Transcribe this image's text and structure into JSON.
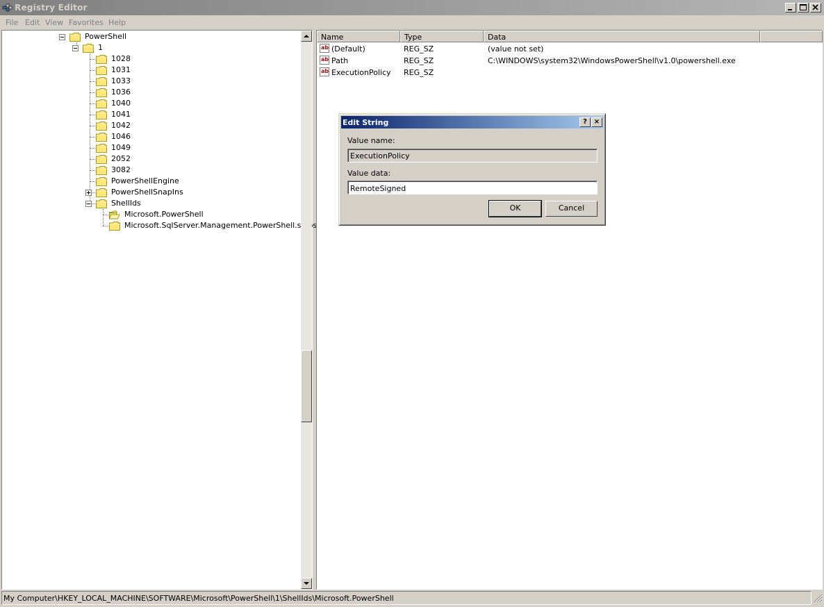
{
  "window": {
    "title": "Registry Editor"
  },
  "menu": [
    "File",
    "Edit",
    "View",
    "Favorites",
    "Help"
  ],
  "tree": [
    {
      "label": "PowerShell",
      "level": 0,
      "expander": "minus"
    },
    {
      "label": "1",
      "level": 1,
      "expander": "minus"
    },
    {
      "label": "1028",
      "level": 2
    },
    {
      "label": "1031",
      "level": 2
    },
    {
      "label": "1033",
      "level": 2
    },
    {
      "label": "1036",
      "level": 2
    },
    {
      "label": "1040",
      "level": 2
    },
    {
      "label": "1041",
      "level": 2
    },
    {
      "label": "1042",
      "level": 2
    },
    {
      "label": "1046",
      "level": 2
    },
    {
      "label": "1049",
      "level": 2
    },
    {
      "label": "2052",
      "level": 2
    },
    {
      "label": "3082",
      "level": 2
    },
    {
      "label": "PowerShellEngine",
      "level": 2
    },
    {
      "label": "PowerShellSnapIns",
      "level": 2,
      "expander": "plus"
    },
    {
      "label": "ShellIds",
      "level": 2,
      "expander": "minus"
    },
    {
      "label": "Microsoft.PowerShell",
      "level": 3,
      "open": true
    },
    {
      "label": "Microsoft.SqlServer.Management.PowerShell.sqlps",
      "level": 3
    }
  ],
  "list": {
    "columns": [
      "Name",
      "Type",
      "Data"
    ],
    "rows": [
      {
        "name": "(Default)",
        "type": "REG_SZ",
        "data": "(value not set)"
      },
      {
        "name": "Path",
        "type": "REG_SZ",
        "data": "C:\\WINDOWS\\system32\\WindowsPowerShell\\v1.0\\powershell.exe"
      },
      {
        "name": "ExecutionPolicy",
        "type": "REG_SZ",
        "data": ""
      }
    ]
  },
  "dialog": {
    "title": "Edit String",
    "help_glyph": "?",
    "close_glyph": "×",
    "value_name_label": "Value name:",
    "value_name": "ExecutionPolicy",
    "value_data_label": "Value data:",
    "value_data": "RemoteSigned",
    "ok_label": "OK",
    "cancel_label": "Cancel"
  },
  "status": {
    "path": "My Computer\\HKEY_LOCAL_MACHINE\\SOFTWARE\\Microsoft\\PowerShell\\1\\ShellIds\\Microsoft.PowerShell"
  },
  "colors": {
    "title_active": "#0a246a",
    "title_inactive": "#808080",
    "face": "#d4d0c8",
    "folder": "#ffe57a"
  }
}
